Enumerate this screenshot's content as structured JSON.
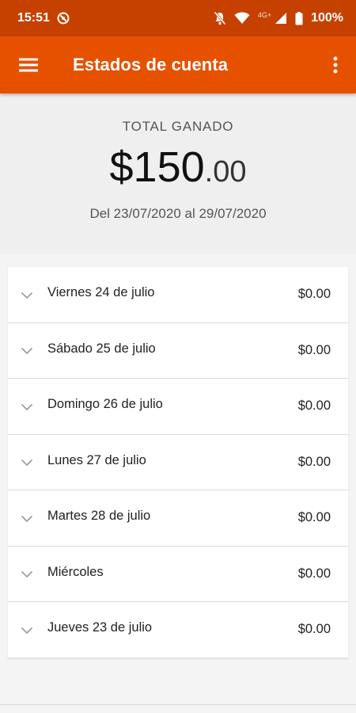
{
  "status_bar": {
    "time": "15:51",
    "network_label": "4G+",
    "battery": "100%"
  },
  "app_bar": {
    "title": "Estados de cuenta",
    "background_color": "#e65100",
    "status_color": "#c64100"
  },
  "summary": {
    "label": "TOTAL GANADO",
    "amount_integer": "$150",
    "amount_decimal": ".00",
    "date_range": "Del 23/07/2020 al 29/07/2020"
  },
  "days": [
    {
      "label": "Viernes 24 de julio",
      "amount": "$0.00"
    },
    {
      "label": "Sábado 25 de julio",
      "amount": "$0.00"
    },
    {
      "label": "Domingo 26 de julio",
      "amount": "$0.00"
    },
    {
      "label": "Lunes 27 de julio",
      "amount": "$0.00"
    },
    {
      "label": "Martes 28 de julio",
      "amount": "$0.00"
    },
    {
      "label": "Miércoles",
      "amount": "$0.00"
    },
    {
      "label": "Jueves 23 de julio",
      "amount": "$0.00"
    }
  ]
}
